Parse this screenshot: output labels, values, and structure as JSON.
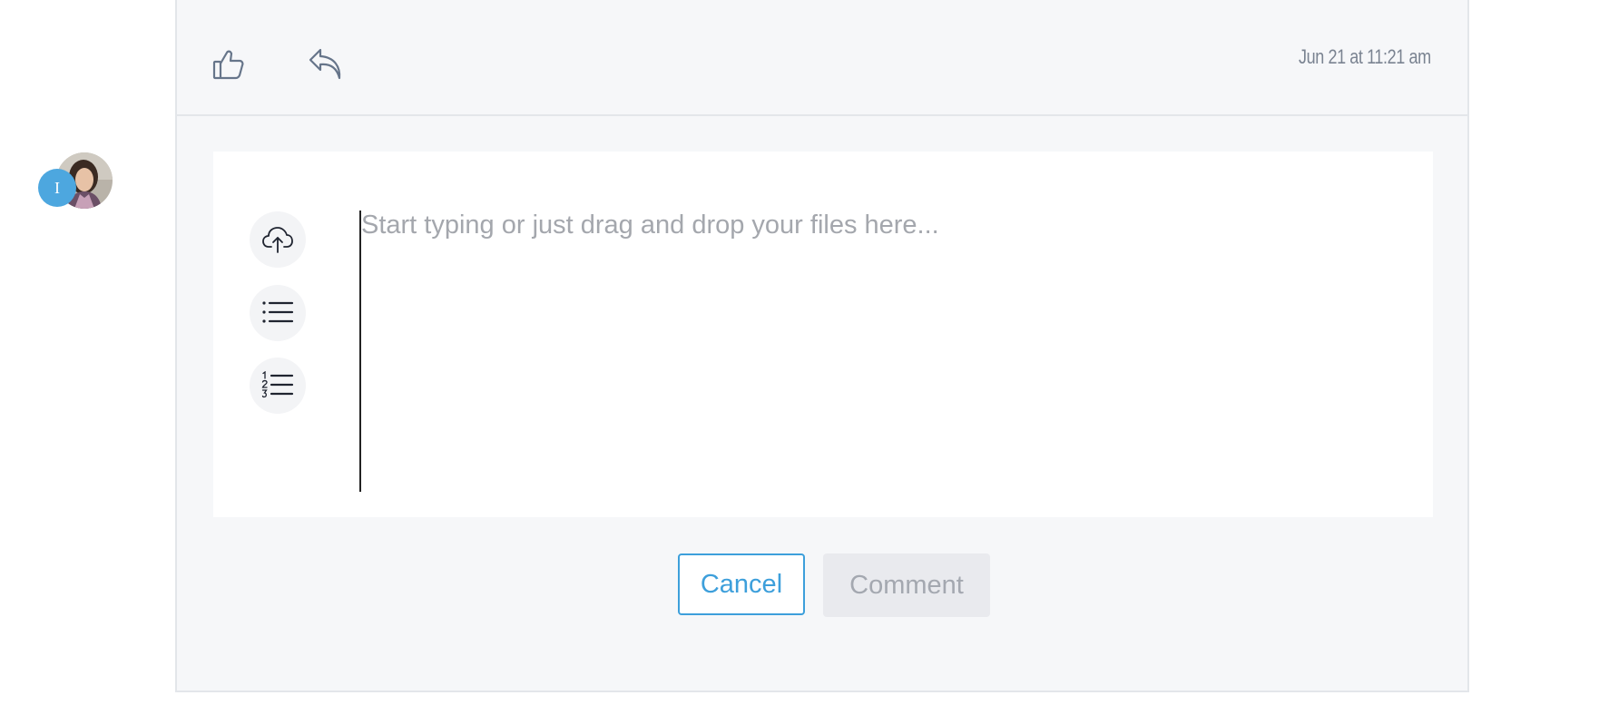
{
  "comment_footer": {
    "like_icon": "thumbs-up-icon",
    "reply_icon": "reply-icon",
    "timestamp": "Jun 21 at 11:21 am"
  },
  "user": {
    "avatar_badge_text": "I"
  },
  "editor": {
    "placeholder": "Start typing or just drag and drop your files here...",
    "value": "",
    "tools": [
      {
        "icon": "cloud-upload-icon"
      },
      {
        "icon": "bulleted-list-icon"
      },
      {
        "icon": "numbered-list-icon"
      }
    ]
  },
  "actions": {
    "cancel_label": "Cancel",
    "comment_label": "Comment"
  },
  "colors": {
    "accent": "#3d9fdb",
    "badge": "#4da7df",
    "panel_bg": "#f6f7f9",
    "border": "#e3e6ea",
    "disabled_bg": "#e9eaee",
    "disabled_text": "#a4a8b0"
  }
}
